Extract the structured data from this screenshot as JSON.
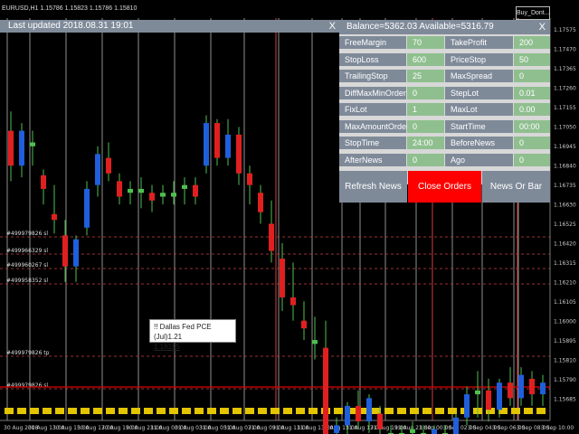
{
  "window": {
    "symbol_line": "EURUSD,H1  1.15786 1.15823 1.15786 1.15810",
    "badge": "Buy_Dont...",
    "last_updated": "Last updated 2018.08.31 19:01",
    "close_glyph": "X"
  },
  "panel": {
    "header": "Balance=5362.03 Available=5316.79",
    "close_glyph": "X",
    "rows": [
      {
        "label": "FreeMargin",
        "value": "70",
        "label2": "TakeProfit",
        "value2": "200"
      },
      {
        "label": "StopLoss",
        "value": "600",
        "label2": "PriceStop",
        "value2": "50"
      },
      {
        "label": "TrailingStop",
        "value": "25",
        "label2": "MaxSpread",
        "value2": "0"
      },
      {
        "label": "DiffMaxMinOrder",
        "value": "0",
        "label2": "StepLot",
        "value2": "0.01"
      },
      {
        "label": "FixLot",
        "value": "1",
        "label2": "MaxLot",
        "value2": "0.00"
      },
      {
        "label": "MaxAmountOrders",
        "value": "0",
        "label2": "StartTime",
        "value2": "00:00"
      },
      {
        "label": "StopTime",
        "value": "24:00",
        "label2": "BeforeNews",
        "value2": "0"
      },
      {
        "label": "AfterNews",
        "value": "0",
        "label2": "Ago",
        "value2": "0"
      }
    ],
    "buttons": {
      "refresh": "Refresh News",
      "close_orders": "Close Orders",
      "news_or_bar": "News Or Bar"
    }
  },
  "tooltip": {
    "title": "!! Dallas Fed PCE (Jul)1.21",
    "value": "1.16195"
  },
  "order_labels": [
    "#499979826 sl",
    "#499966329 sl",
    "#499960267 sl",
    "#499958352 sl",
    "#499979826 tp",
    "#499979826 sl"
  ],
  "price_labels": [
    "1.17575",
    "1.17470",
    "1.17365",
    "1.17260",
    "1.17155",
    "1.17050",
    "1.16945",
    "1.16840",
    "1.16735",
    "1.16630",
    "1.16525",
    "1.16420",
    "1.16315",
    "1.16210",
    "1.16105",
    "1.16000",
    "1.15895",
    "1.15810",
    "1.15790",
    "1.15685"
  ],
  "time_labels": [
    "30 Aug 2018",
    "30 Aug 13:00",
    "30 Aug 15:00",
    "30 Aug 17:00",
    "30 Aug 19:00",
    "30 Aug 21:00",
    "31 Aug 00:00",
    "31 Aug 03:00",
    "31 Aug 05:00",
    "31 Aug 07:00",
    "31 Aug 09:00",
    "31 Aug 11:00",
    "31 Aug 13:00",
    "31 Aug 15:00",
    "31 Aug 17:00",
    "31 Aug 19:00",
    "31 Aug 21:00",
    "3 Sep 00:00",
    "3 Sep 02:00",
    "3 Sep 04:00",
    "3 Sep 06:00",
    "3 Sep 08:00",
    "3 Sep 10:00"
  ],
  "colors": {
    "bull": "#1f5fdc",
    "bear": "#e02020",
    "doji": "#4fc04f",
    "grid_v": "#ffffff",
    "order": "#d04040",
    "event": "#e2c400",
    "accent_red": "#e00000",
    "panel_label": "#7f8a99",
    "panel_value": "#8fbf8f"
  },
  "chart_data": {
    "type": "candlestick",
    "y_axis_range": [
      1.15685,
      1.17575
    ],
    "candles": [
      [
        1.1718,
        1.1728,
        1.1692,
        1.17
      ],
      [
        1.17,
        1.1722,
        1.1694,
        1.1718
      ],
      [
        1.1712,
        1.1718,
        1.17,
        1.171
      ],
      [
        1.1695,
        1.1698,
        1.168,
        1.1688
      ],
      [
        1.1675,
        1.169,
        1.1665,
        1.1672
      ],
      [
        1.1664,
        1.1672,
        1.164,
        1.1648
      ],
      [
        1.1648,
        1.1664,
        1.164,
        1.1662
      ],
      [
        1.1668,
        1.1692,
        1.1664,
        1.1688
      ],
      [
        1.169,
        1.171,
        1.1684,
        1.1706
      ],
      [
        1.1704,
        1.1712,
        1.1692,
        1.1696
      ],
      [
        1.1692,
        1.1696,
        1.168,
        1.1684
      ],
      [
        1.1686,
        1.1692,
        1.168,
        1.1688
      ],
      [
        1.1688,
        1.1694,
        1.1678,
        1.1686
      ],
      [
        1.1686,
        1.169,
        1.1676,
        1.1682
      ],
      [
        1.1684,
        1.169,
        1.168,
        1.1686
      ],
      [
        1.1686,
        1.1692,
        1.168,
        1.1684
      ],
      [
        1.1688,
        1.1694,
        1.168,
        1.169
      ],
      [
        1.169,
        1.1694,
        1.168,
        1.1684
      ],
      [
        1.17,
        1.1726,
        1.1696,
        1.1722
      ],
      [
        1.1722,
        1.1724,
        1.17,
        1.1704
      ],
      [
        1.1704,
        1.1724,
        1.17,
        1.1716
      ],
      [
        1.1716,
        1.172,
        1.169,
        1.1696
      ],
      [
        1.1696,
        1.17,
        1.168,
        1.169
      ],
      [
        1.1686,
        1.169,
        1.167,
        1.1676
      ],
      [
        1.167,
        1.1682,
        1.165,
        1.1656
      ],
      [
        1.1652,
        1.166,
        1.1625,
        1.1632
      ],
      [
        1.1632,
        1.165,
        1.162,
        1.1628
      ],
      [
        1.162,
        1.163,
        1.161,
        1.1616
      ],
      [
        1.161,
        1.1622,
        1.16,
        1.1608
      ],
      [
        1.1606,
        1.162,
        1.1546,
        1.1558
      ],
      [
        1.1562,
        1.157,
        1.1556,
        1.1566
      ],
      [
        1.1566,
        1.1578,
        1.156,
        1.1576
      ],
      [
        1.1576,
        1.1584,
        1.1564,
        1.1568
      ],
      [
        1.1568,
        1.1582,
        1.1562,
        1.158
      ],
      [
        1.1572,
        1.1576,
        1.155,
        1.1564
      ],
      [
        1.1562,
        1.1566,
        1.1556,
        1.1562
      ],
      [
        1.156,
        1.1566,
        1.1556,
        1.1562
      ],
      [
        1.1562,
        1.1568,
        1.1558,
        1.1564
      ],
      [
        1.1562,
        1.1566,
        1.1556,
        1.156
      ],
      [
        1.156,
        1.1566,
        1.1554,
        1.1564
      ],
      [
        1.1562,
        1.1566,
        1.1556,
        1.156
      ],
      [
        1.156,
        1.1572,
        1.1556,
        1.157
      ],
      [
        1.157,
        1.1586,
        1.1566,
        1.1582
      ],
      [
        1.1582,
        1.1594,
        1.157,
        1.1584
      ],
      [
        1.1584,
        1.159,
        1.1568,
        1.1574
      ],
      [
        1.1574,
        1.159,
        1.157,
        1.1588
      ],
      [
        1.1588,
        1.1596,
        1.1576,
        1.158
      ],
      [
        1.158,
        1.1596,
        1.1576,
        1.1592
      ],
      [
        1.159,
        1.1594,
        1.1576,
        1.1582
      ],
      [
        1.1582,
        1.1592,
        1.1576,
        1.1588
      ]
    ]
  }
}
